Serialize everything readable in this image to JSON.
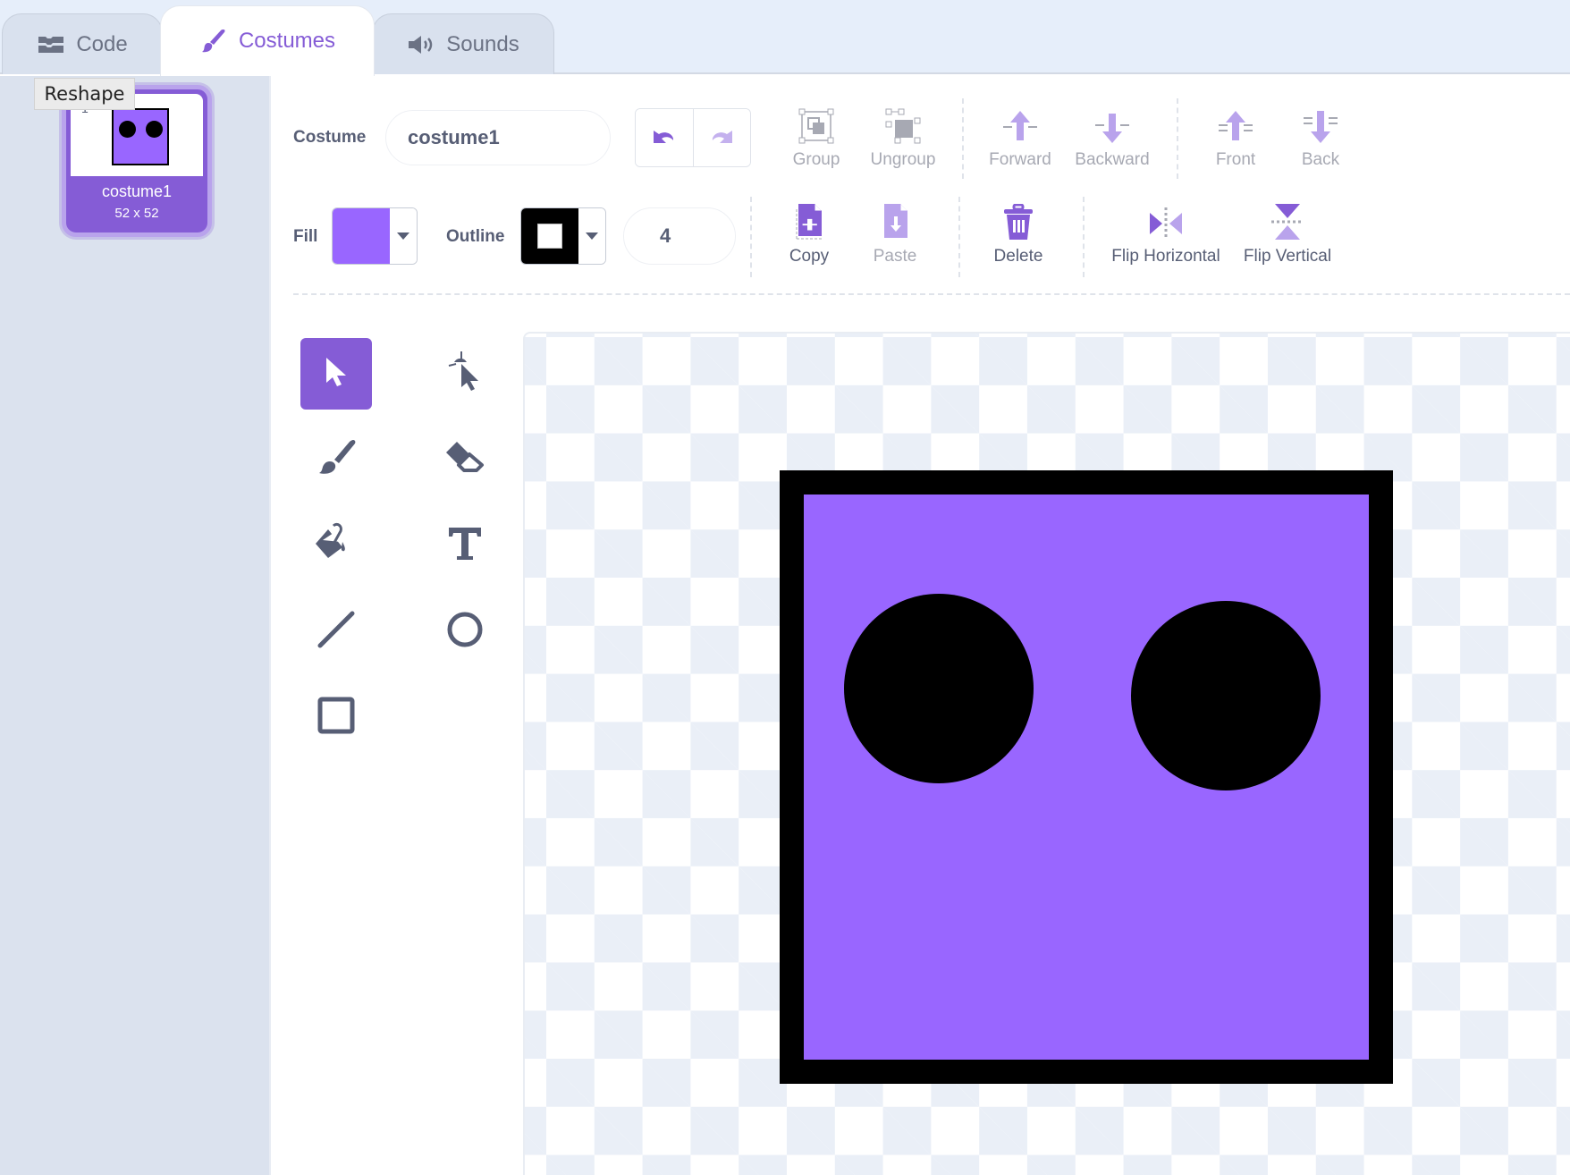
{
  "tabs": [
    {
      "label": "Code",
      "icon": "code-blocks-icon",
      "active": false
    },
    {
      "label": "Costumes",
      "icon": "paintbrush-icon",
      "active": true
    },
    {
      "label": "Sounds",
      "icon": "speaker-icon",
      "active": false
    }
  ],
  "tooltip": "Reshape",
  "costume_list": [
    {
      "index": "1",
      "name": "costume1",
      "size": "52 x 52",
      "selected": true
    }
  ],
  "toolbar": {
    "costume_label": "Costume",
    "costume_name": "costume1",
    "undo_label": "Undo",
    "redo_label": "Redo",
    "group": "Group",
    "ungroup": "Ungroup",
    "forward": "Forward",
    "backward": "Backward",
    "front": "Front",
    "back": "Back",
    "fill_label": "Fill",
    "outline_label": "Outline",
    "outline_width": "4",
    "copy": "Copy",
    "paste": "Paste",
    "delete": "Delete",
    "flip_horizontal": "Flip Horizontal",
    "flip_vertical": "Flip Vertical"
  },
  "colors": {
    "accent": "#855cd6",
    "fill": "#9966ff",
    "outline": "#000000"
  },
  "tools": [
    {
      "name": "select",
      "icon": "select-arrow-icon",
      "active": true
    },
    {
      "name": "reshape",
      "icon": "reshape-icon",
      "active": false
    },
    {
      "name": "brush",
      "icon": "brush-icon",
      "active": false
    },
    {
      "name": "eraser",
      "icon": "eraser-icon",
      "active": false
    },
    {
      "name": "fill",
      "icon": "fill-bucket-icon",
      "active": false
    },
    {
      "name": "text",
      "icon": "text-icon",
      "active": false
    },
    {
      "name": "line",
      "icon": "line-icon",
      "active": false
    },
    {
      "name": "circle",
      "icon": "circle-icon",
      "active": false
    },
    {
      "name": "rectangle",
      "icon": "rectangle-icon",
      "active": false
    }
  ]
}
